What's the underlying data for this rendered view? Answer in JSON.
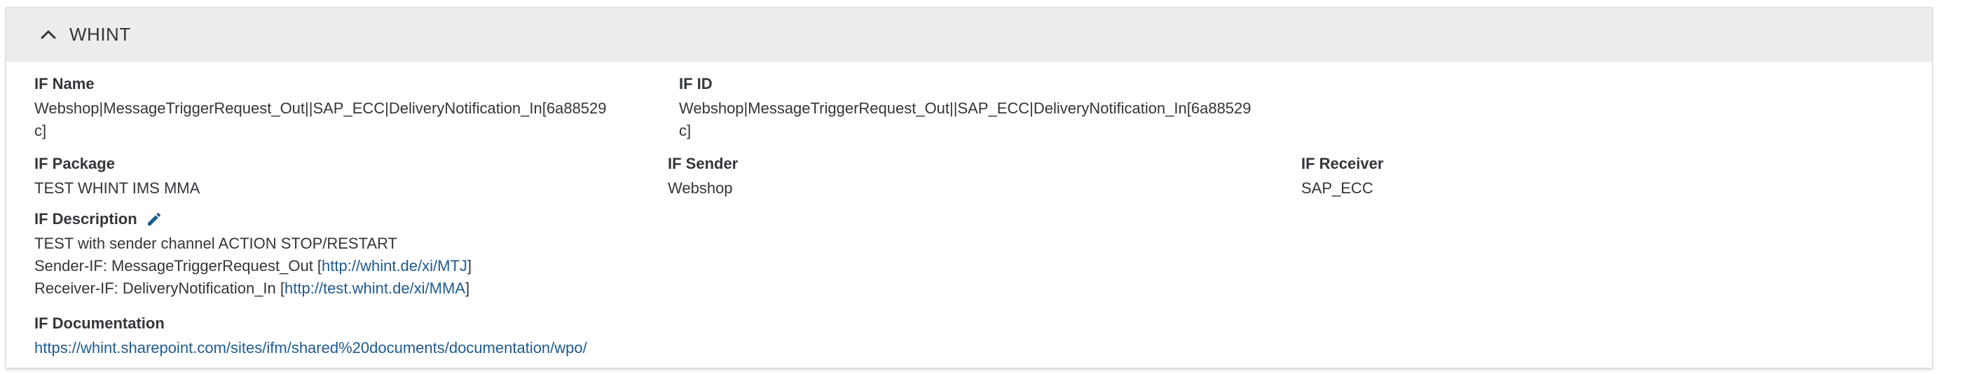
{
  "panel": {
    "title": "WHINT"
  },
  "fields": {
    "if_name": {
      "label": "IF Name",
      "value": "Webshop|MessageTriggerRequest_Out||SAP_ECC|DeliveryNotification_In[6a88529c]"
    },
    "if_id": {
      "label": "IF ID",
      "value": "Webshop|MessageTriggerRequest_Out||SAP_ECC|DeliveryNotification_In[6a88529c]"
    },
    "if_package": {
      "label": "IF Package",
      "value": "TEST WHINT IMS MMA"
    },
    "if_sender": {
      "label": "IF Sender",
      "value": "Webshop"
    },
    "if_receiver": {
      "label": "IF Receiver",
      "value": "SAP_ECC"
    },
    "if_description": {
      "label": "IF Description",
      "line1": "TEST with sender channel  ACTION STOP/RESTART",
      "line2_prefix": "Sender-IF: MessageTriggerRequest_Out [",
      "line2_link": "http://whint.de/xi/MTJ",
      "line2_suffix": "]",
      "line3_prefix": "Receiver-IF: DeliveryNotification_In [",
      "line3_link": "http://test.whint.de/xi/MMA",
      "line3_suffix": "]"
    },
    "if_documentation": {
      "label": "IF Documentation",
      "link": "https://whint.sharepoint.com/sites/ifm/shared%20documents/documentation/wpo/"
    }
  },
  "colors": {
    "header_bg": "#ededed",
    "link": "#1f5b8f",
    "text": "#32363a"
  },
  "icons": {
    "collapse": "chevron-up-icon",
    "edit": "pencil-icon"
  }
}
